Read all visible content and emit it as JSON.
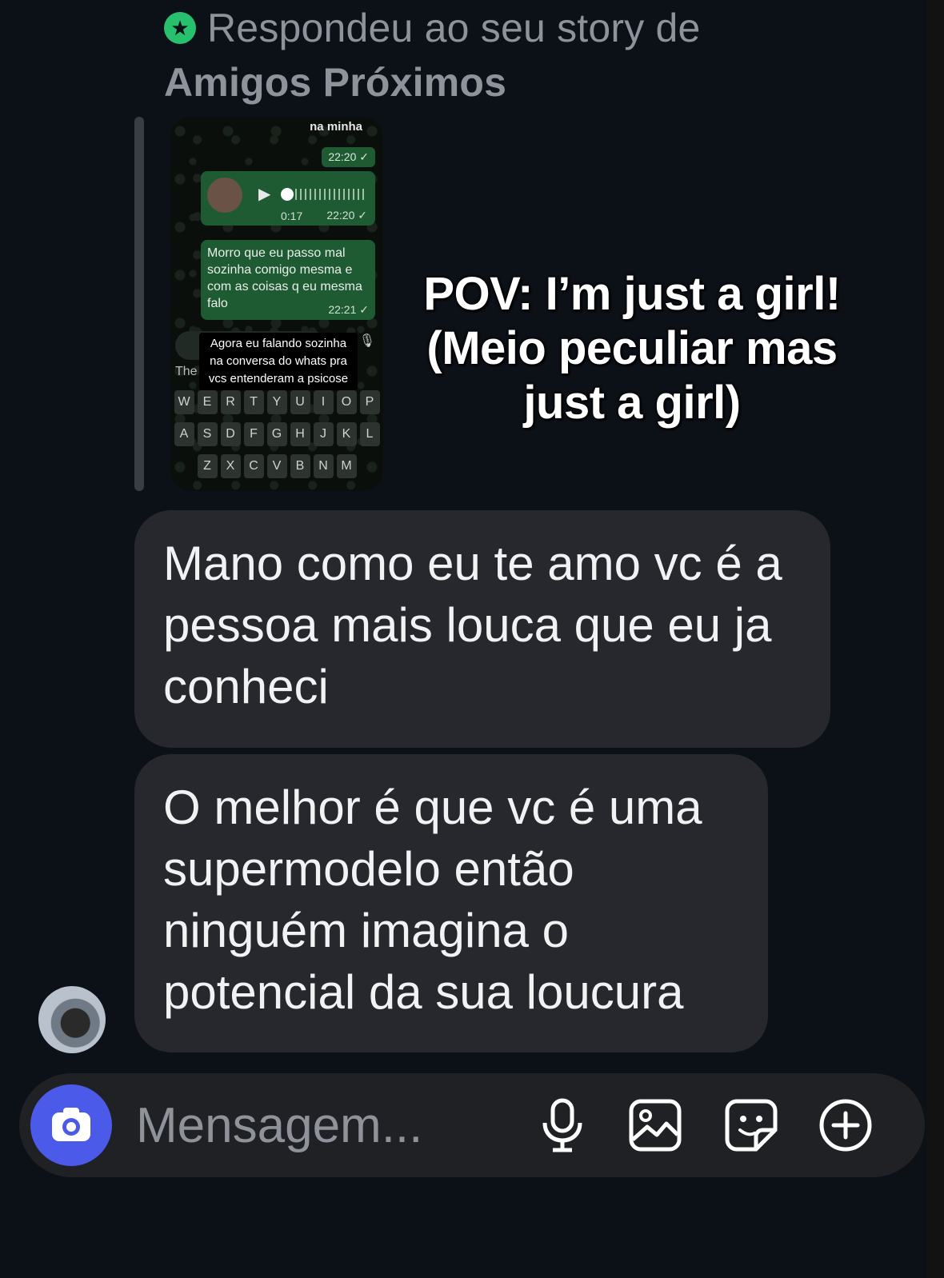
{
  "reply_header": {
    "text": "Respondeu ao seu story de",
    "list_name": "Amigos Próximos"
  },
  "story": {
    "top_text": "na minha",
    "time_1": "22:20 ✓",
    "audio_duration": "0:17",
    "time_2": "22:20 ✓",
    "bubble_text": "Morro que eu passo mal sozinha comigo mesma e com as coisas q eu mesma falo",
    "time_3": "22:21 ✓",
    "input_hint": "The",
    "caption": "Agora eu falando sozinha na conversa do whats pra vcs entenderam a psicose",
    "keyboard_row_1": [
      "W",
      "E",
      "R",
      "T",
      "Y",
      "U",
      "I",
      "O",
      "P"
    ],
    "keyboard_row_2": [
      "A",
      "S",
      "D",
      "F",
      "G",
      "H",
      "J",
      "K",
      "L"
    ],
    "keyboard_row_3": [
      "Z",
      "X",
      "C",
      "V",
      "B",
      "N",
      "M"
    ]
  },
  "overlay": {
    "pov_text": "POV: I’m just a girl! (Meio peculiar mas just a girl)"
  },
  "messages": [
    {
      "text": "Mano como eu te amo vc é a pessoa mais louca que eu ja conheci"
    },
    {
      "text": "O melhor é que vc é uma supermodelo então ninguém imagina o potencial da sua loucura"
    }
  ],
  "composer": {
    "placeholder": "Mensagem...",
    "icons": [
      "camera-icon",
      "microphone-icon",
      "image-icon",
      "sticker-icon",
      "plus-circle-icon"
    ]
  },
  "colors": {
    "background": "#0c1017",
    "bubble": "#26282d",
    "camera_button": "#4b5ae8",
    "close_friends_badge": "#27c06c",
    "whatsapp_bubble": "#1f5b32"
  }
}
